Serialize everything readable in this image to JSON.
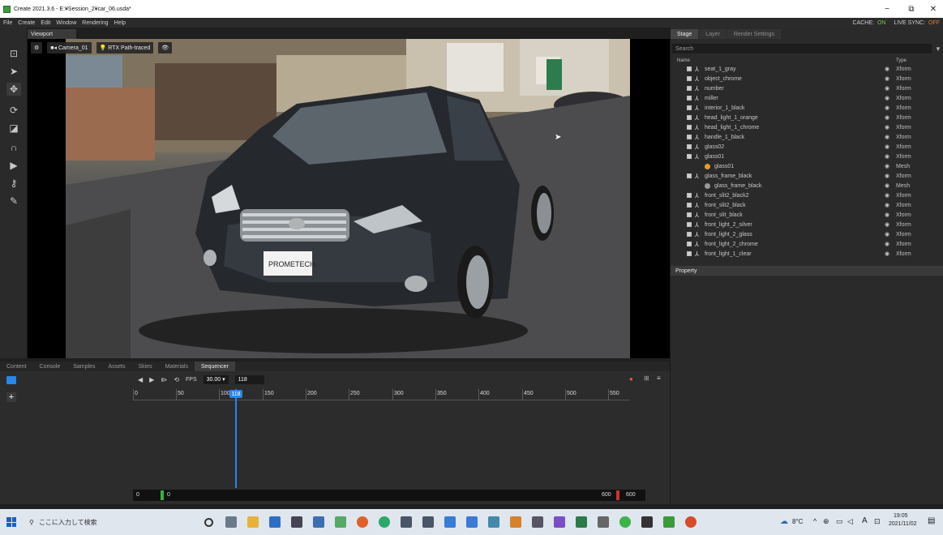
{
  "window": {
    "title": "Create 2021.3.6 - E:¥Session_2¥car_06.usda*",
    "min": "−",
    "max": "⧉",
    "close": "✕"
  },
  "menu": {
    "items": [
      "File",
      "Create",
      "Edit",
      "Window",
      "Rendering",
      "Help"
    ],
    "cache_label": "CACHE:",
    "cache_value": "ON",
    "live_sync_label": "LIVE SYNC:",
    "live_sync_value": "OFF"
  },
  "viewport": {
    "tab": "Viewport",
    "camera": "Camera_01",
    "renderer": "RTX Path-traced",
    "plate_text": "PROMETECH."
  },
  "bottom_tabs": [
    "Content",
    "Console",
    "Samples",
    "Assets",
    "Skies",
    "Materials",
    "Sequencer"
  ],
  "sequencer": {
    "fps_label": "FPS",
    "fps_value": "30.00",
    "current_frame": "118",
    "ruler_labels": [
      "0",
      "50",
      "100",
      "150",
      "200",
      "250",
      "300",
      "350",
      "400",
      "450",
      "500",
      "550"
    ],
    "playhead_label": "118",
    "start_a": "0",
    "start_b": "0",
    "end_a": "600",
    "end_b": "600"
  },
  "stage": {
    "tabs": [
      "Stage",
      "Layer",
      "Render Settings"
    ],
    "search_placeholder": "Search",
    "col_name": "Name",
    "col_type": "Type",
    "rows": [
      {
        "name": "seat_1_gray",
        "type": "Xform"
      },
      {
        "name": "object_chrome",
        "type": "Xform"
      },
      {
        "name": "number",
        "type": "Xform"
      },
      {
        "name": "miller",
        "type": "Xform"
      },
      {
        "name": "interior_1_black",
        "type": "Xform"
      },
      {
        "name": "head_light_1_orange",
        "type": "Xform"
      },
      {
        "name": "head_light_1_chrome",
        "type": "Xform"
      },
      {
        "name": "handle_1_black",
        "type": "Xform"
      },
      {
        "name": "glass02",
        "type": "Xform"
      },
      {
        "name": "glass01",
        "type": "Xform"
      },
      {
        "name": "glass01",
        "type": "Mesh"
      },
      {
        "name": "glass_frame_black",
        "type": "Xform"
      },
      {
        "name": "glass_frame_black",
        "type": "Mesh"
      },
      {
        "name": "front_slit2_black2",
        "type": "Xform"
      },
      {
        "name": "front_slit2_black",
        "type": "Xform"
      },
      {
        "name": "front_slit_black",
        "type": "Xform"
      },
      {
        "name": "front_light_2_silver",
        "type": "Xform"
      },
      {
        "name": "front_light_2_glass",
        "type": "Xform"
      },
      {
        "name": "front_light_2_chrome",
        "type": "Xform"
      },
      {
        "name": "front_light_1_clear",
        "type": "Xform"
      }
    ],
    "property_label": "Property"
  },
  "taskbar": {
    "search_placeholder": "ここに入力して検索",
    "temperature": "8°C",
    "ime": "A",
    "time": "19:05",
    "date": "2021/11/02"
  },
  "colors": {
    "accent": "#2a86e8",
    "cache_on": "#6ccf3c",
    "sync_off": "#e27a3c"
  }
}
